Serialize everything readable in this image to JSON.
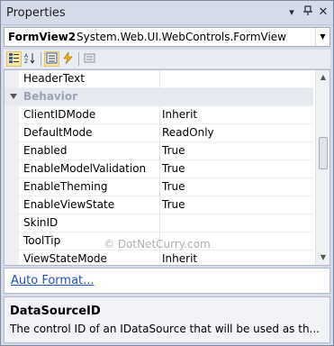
{
  "window": {
    "title": "Properties"
  },
  "object_selector": {
    "name": "FormView2",
    "type": "System.Web.UI.WebControls.FormView"
  },
  "toolbar": {
    "buttons": [
      "categorized-icon",
      "alphabetical-icon",
      "properties-icon",
      "events-icon",
      "property-pages-icon"
    ]
  },
  "grid": {
    "rows": [
      {
        "name": "HeaderText",
        "value": ""
      },
      {
        "name": "Behavior",
        "value": "",
        "category": true
      },
      {
        "name": "ClientIDMode",
        "value": "Inherit"
      },
      {
        "name": "DefaultMode",
        "value": "ReadOnly"
      },
      {
        "name": "Enabled",
        "value": "True"
      },
      {
        "name": "EnableModelValidation",
        "value": "True"
      },
      {
        "name": "EnableTheming",
        "value": "True"
      },
      {
        "name": "EnableViewState",
        "value": "True"
      },
      {
        "name": "SkinID",
        "value": ""
      },
      {
        "name": "ToolTip",
        "value": ""
      },
      {
        "name": "ViewStateMode",
        "value": "Inherit"
      }
    ]
  },
  "watermark": "© DotNetCurry.com",
  "commands": {
    "auto_format": "Auto Format..."
  },
  "description": {
    "title": "DataSourceID",
    "text": "The control ID of an IDataSource that will be used as th..."
  }
}
